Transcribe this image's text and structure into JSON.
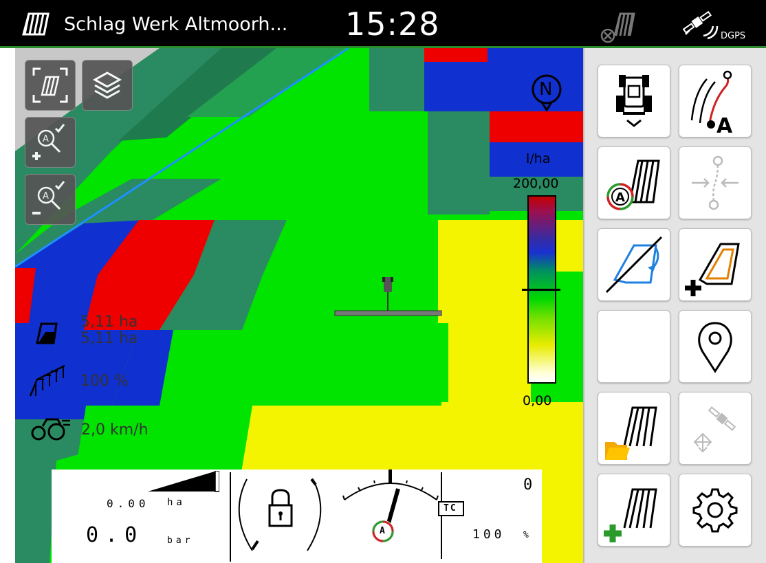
{
  "header": {
    "field_name": "Schlag Werk Altmoorh...",
    "time": "15:28",
    "gps_mode": "DGPS"
  },
  "map": {
    "north_label": "N",
    "stats": {
      "area_1": "5,11 ha",
      "area_2": "5,11 ha",
      "boom_percent": "100 %",
      "speed": "2,0 km/h"
    },
    "legend": {
      "unit": "l/ha",
      "max": "200,00",
      "min": "0,00"
    }
  },
  "bottom_panel": {
    "area_value": "0.00",
    "area_unit": "ha",
    "pressure_value": "0.0",
    "pressure_unit": "bar",
    "top_right_value": "0",
    "tc_label": "TC",
    "rate_value": "100",
    "rate_unit": "%",
    "gauge_mode_letter": "A"
  },
  "sidebar": {
    "buttons": [
      {
        "name": "tractor-view-button",
        "icon": "tractor-view-icon",
        "enabled": true
      },
      {
        "name": "guidance-line-a-button",
        "icon": "guidance-ab-line-icon",
        "enabled": true,
        "letter": "A"
      },
      {
        "name": "section-control-auto-button",
        "icon": "section-control-auto-icon",
        "enabled": true,
        "letter": "A"
      },
      {
        "name": "ab-line-shift-button",
        "icon": "line-shift-icon",
        "enabled": false
      },
      {
        "name": "boundary-edit-button",
        "icon": "boundary-edit-icon",
        "enabled": true
      },
      {
        "name": "boundary-add-button",
        "icon": "boundary-add-icon",
        "enabled": true
      },
      {
        "name": "empty-button",
        "icon": "",
        "enabled": true
      },
      {
        "name": "location-pin-button",
        "icon": "location-pin-icon",
        "enabled": true
      },
      {
        "name": "open-field-button",
        "icon": "field-folder-icon",
        "enabled": true
      },
      {
        "name": "gps-correction-button",
        "icon": "satellite-move-icon",
        "enabled": false
      },
      {
        "name": "new-field-button",
        "icon": "field-add-icon",
        "enabled": true
      },
      {
        "name": "settings-button",
        "icon": "gear-icon",
        "enabled": true
      }
    ]
  },
  "colors": {
    "green": "#00e400",
    "dark_green": "#2a8a62",
    "blue": "#1030d0",
    "red": "#ee0000",
    "yellow": "#f4f400",
    "grey": "#c8c8c8",
    "line": "#1e90ff"
  }
}
